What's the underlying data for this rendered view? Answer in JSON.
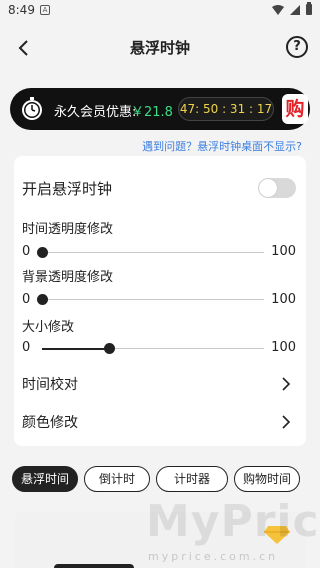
{
  "status_bar": {
    "time": "8:49",
    "notification_badge": "A",
    "icons": [
      "wifi-icon",
      "signal-icon",
      "battery-icon"
    ]
  },
  "header": {
    "title": "悬浮时钟",
    "help_glyph": "?"
  },
  "promo": {
    "label": "永久会员优惠:",
    "price": "￥21.8",
    "countdown": "47: 50 : 31 : 17",
    "buy_label": "购",
    "price_color": "#3ddc84",
    "countdown_color": "#f0d44a",
    "buy_color": "#e2232a"
  },
  "help_link": "遇到问题？悬浮时钟桌面不显示?",
  "settings": {
    "toggle": {
      "label": "开启悬浮时钟",
      "on": false
    },
    "sliders": [
      {
        "label": "时间透明度修改",
        "min": "0",
        "max": "100",
        "value": 0
      },
      {
        "label": "背景透明度修改",
        "min": "0",
        "max": "100",
        "value": 0
      },
      {
        "label": "大小修改",
        "min": "0",
        "max": "100",
        "value": 30
      }
    ],
    "menu": [
      {
        "label": "时间校对"
      },
      {
        "label": "颜色修改"
      }
    ]
  },
  "tabs": [
    {
      "label": "悬浮时间",
      "active": true
    },
    {
      "label": "倒计时",
      "active": false
    },
    {
      "label": "计时器",
      "active": false
    },
    {
      "label": "购物时间",
      "active": false
    }
  ],
  "watermark": {
    "text": "MyPrice",
    "sub": "myprice.com.cn"
  }
}
